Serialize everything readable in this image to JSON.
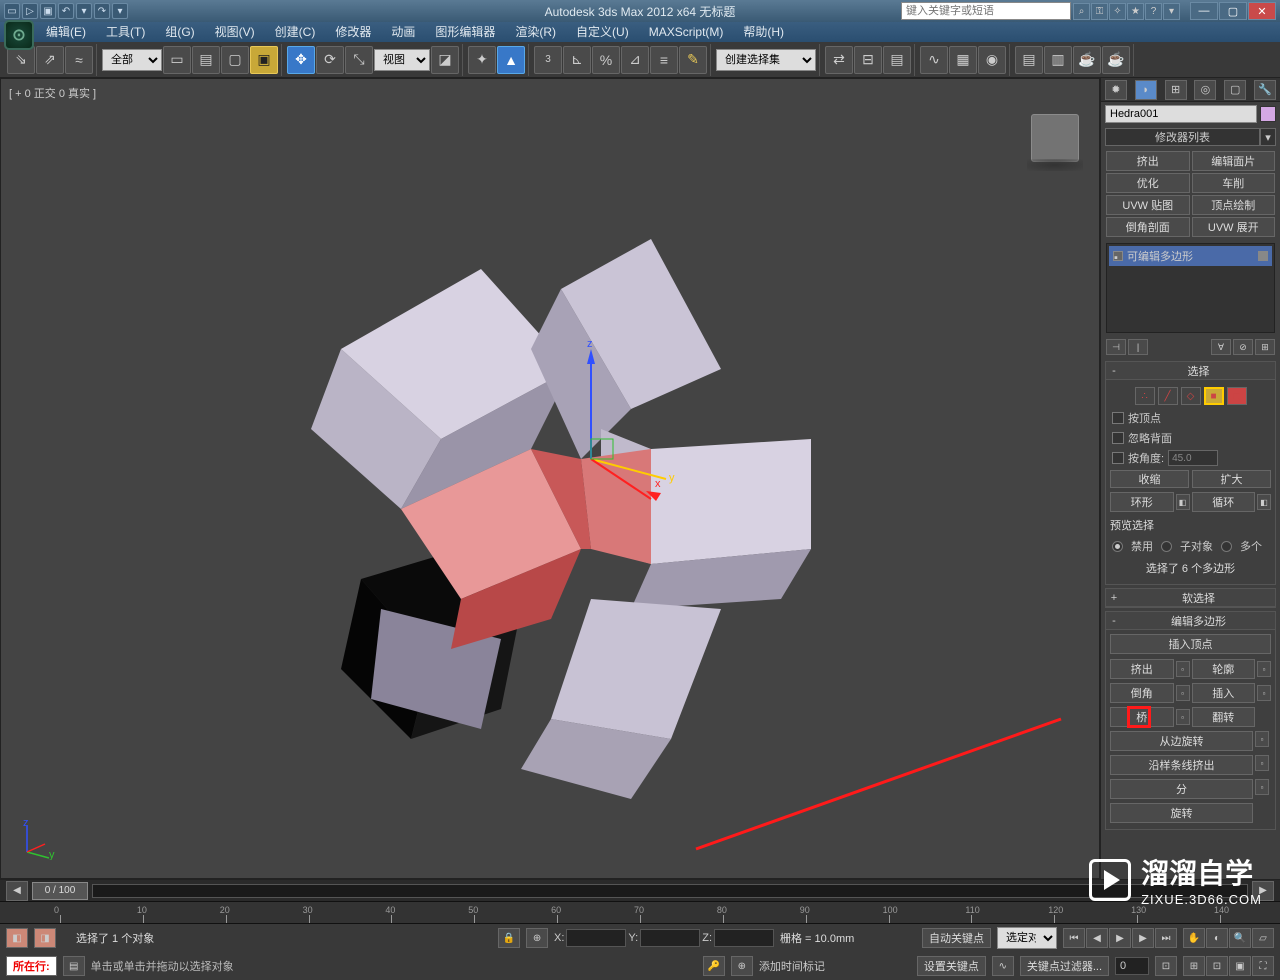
{
  "titlebar": {
    "app_title": "Autodesk 3ds Max 2012 x64   无标题",
    "search_placeholder": "键入关键字或短语"
  },
  "menu": {
    "items": [
      "编辑(E)",
      "工具(T)",
      "组(G)",
      "视图(V)",
      "创建(C)",
      "修改器",
      "动画",
      "图形编辑器",
      "渲染(R)",
      "自定义(U)",
      "MAXScript(M)",
      "帮助(H)"
    ]
  },
  "toolbar": {
    "selection_filter": "全部",
    "view_mode": "视图",
    "named_sel": "创建选择集"
  },
  "viewport": {
    "label": "[ + 0 正交 0 真实 ]"
  },
  "command_panel": {
    "object_name": "Hedra001",
    "modifier_list_label": "修改器列表",
    "modifier_buttons": [
      "挤出",
      "编辑面片",
      "优化",
      "车削",
      "UVW 贴图",
      "顶点绘制",
      "倒角剖面",
      "UVW 展开"
    ],
    "stack_item": "可编辑多边形",
    "rollout_selection": {
      "title": "选择",
      "by_vertex": "按顶点",
      "ignore_backfacing": "忽略背面",
      "by_angle": "按角度:",
      "angle_value": "45.0",
      "shrink": "收缩",
      "grow": "扩大",
      "ring": "环形",
      "loop": "循环",
      "preview_label": "预览选择",
      "disable": "禁用",
      "sub": "子对象",
      "multi": "多个",
      "info": "选择了 6 个多边形"
    },
    "rollout_soft": "软选择",
    "rollout_edit_poly": {
      "title": "编辑多边形",
      "insert_vertex": "插入顶点",
      "extrude": "挤出",
      "outline": "轮廓",
      "bevel": "倒角",
      "inset": "插入",
      "bridge": "桥",
      "flip": "翻转",
      "hinge": "从边旋转",
      "extrude_spline": "沿样条线挤出",
      "split": "分",
      "rotate": "旋转"
    }
  },
  "status": {
    "timeslider": "0 / 100",
    "ticks": [
      0,
      10,
      20,
      30,
      40,
      50,
      60,
      70,
      80,
      90,
      100,
      110,
      120,
      130,
      140
    ],
    "selected": "选择了 1 个对象",
    "prompt": "单击或单击并拖动以选择对象",
    "now_at": "所在行:",
    "add_time_tag": "添加时间标记",
    "grid": "栅格 = 10.0mm",
    "auto_key": "自动关键点",
    "set_key": "设置关键点",
    "key_filter": "关键点过滤器...",
    "sel_lock": "选定对",
    "x_label": "X:",
    "y_label": "Y:",
    "z_label": "Z:"
  },
  "watermark": {
    "text": "溜溜自学",
    "url": "ZIXUE.3D66.COM"
  }
}
